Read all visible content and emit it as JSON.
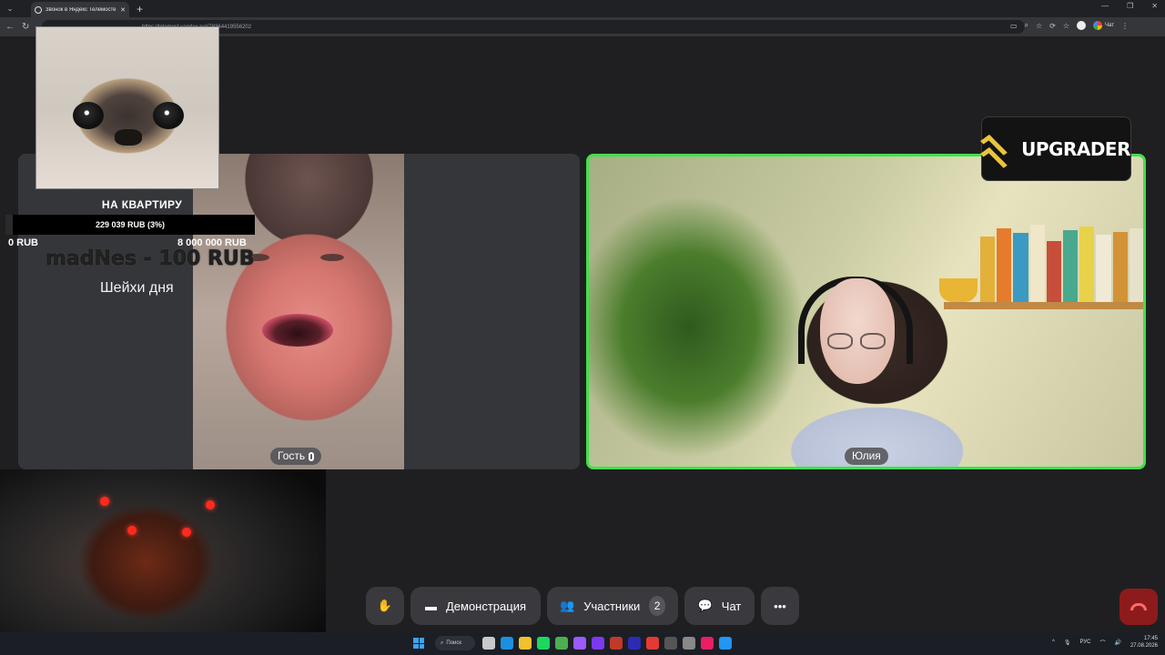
{
  "browser": {
    "tab_title": "Звонок в Яндекс Телемосте",
    "address": "https://telemost.yandex.ru/j/78364419556202",
    "chat_label": "Чат"
  },
  "overlay": {
    "goal_title": "НА КВАРТИРУ",
    "goal_progress_text": "229 039 RUB (3%)",
    "goal_progress_fraction": 0.03,
    "goal_min": "0 RUB",
    "goal_max": "8 000 000 RUB",
    "donation": "madNes - 100 RUB",
    "donation_message": "Шейхи дня"
  },
  "participants": [
    {
      "name": "Гость",
      "mic": "on"
    },
    {
      "name": "Юлия",
      "active_speaker": true
    }
  ],
  "sponsor": {
    "label": "UPGRADER",
    "color": "#e9c53c"
  },
  "toolbar": {
    "raise_hand_icon": "hand-icon",
    "demo_label": "Демонстрация",
    "participants_label": "Участники",
    "participants_count": "2",
    "chat_label": "Чат",
    "more_icon": "more-icon"
  },
  "taskbar": {
    "search_label": "Поиск",
    "lang": "РУС",
    "time": "17:45",
    "date": "27.08.2026"
  },
  "colors": {
    "active_border": "#3fe14a",
    "end_call": "#8d1b1b",
    "background": "#1f1f22"
  }
}
